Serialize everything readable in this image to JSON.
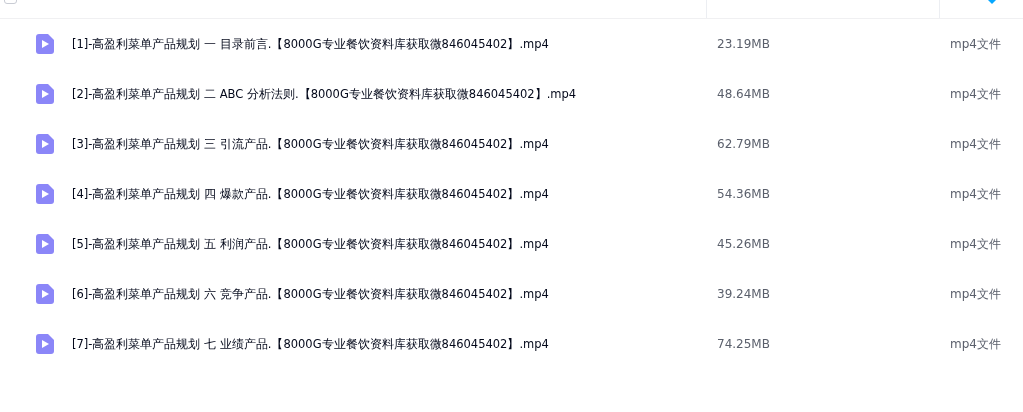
{
  "table": {
    "header": {
      "checked": false
    },
    "rows": [
      {
        "name": "[1]-高盈利菜单产品规划 一 目录前言.【8000G专业餐饮资料库获取微846045402】.mp4",
        "size": "23.19MB",
        "type": "mp4文件",
        "selected": false
      },
      {
        "name": "[2]-高盈利菜单产品规划 二 ABC 分析法则.【8000G专业餐饮资料库获取微846045402】.mp4",
        "size": "48.64MB",
        "type": "mp4文件",
        "selected": false
      },
      {
        "name": "[3]-高盈利菜单产品规划 三 引流产品.【8000G专业餐饮资料库获取微846045402】.mp4",
        "size": "62.79MB",
        "type": "mp4文件",
        "selected": false
      },
      {
        "name": "[4]-高盈利菜单产品规划 四 爆款产品.【8000G专业餐饮资料库获取微846045402】.mp4",
        "size": "54.36MB",
        "type": "mp4文件",
        "selected": false
      },
      {
        "name": "[5]-高盈利菜单产品规划 五 利润产品.【8000G专业餐饮资料库获取微846045402】.mp4",
        "size": "45.26MB",
        "type": "mp4文件",
        "selected": false
      },
      {
        "name": "[6]-高盈利菜单产品规划 六 竞争产品.【8000G专业餐饮资料库获取微846045402】.mp4",
        "size": "39.24MB",
        "type": "mp4文件",
        "selected": false
      },
      {
        "name": "[7]-高盈利菜单产品规划 七 业绩产品.【8000G专业餐饮资料库获取微846045402】.mp4",
        "size": "74.25MB",
        "type": "mp4文件",
        "selected": false
      }
    ]
  }
}
